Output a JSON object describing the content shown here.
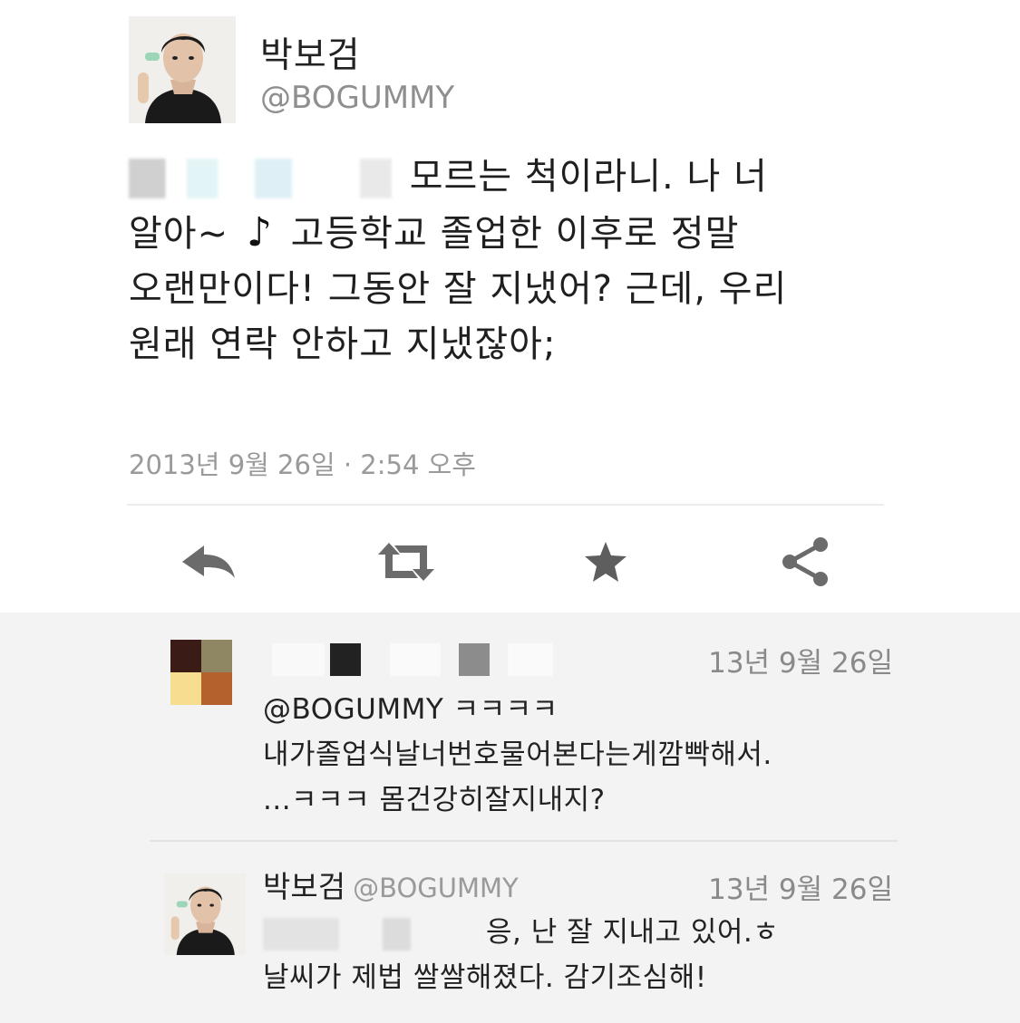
{
  "profile": {
    "display_name": "박보검",
    "handle": "@BOGUMMY",
    "avatar_icon": "person-avatar-icon"
  },
  "tweet": {
    "line1": "모르는 척이라니. 나 너",
    "line2_a": "알아~",
    "line2_note": "♪",
    "line2_b": "고등학교 졸업한 이후로 정말",
    "line3": "오랜만이다! 그동안 잘 지냈어? 근데, 우리",
    "line4": "원래 연락 안하고 지냈잖아;",
    "timestamp": "2013년 9월 26일 · 2:54 오후"
  },
  "actions": {
    "reply_icon": "reply-arrow-icon",
    "retweet_icon": "retweet-icon",
    "favorite_icon": "star-icon",
    "share_icon": "share-icon"
  },
  "replies": [
    {
      "time": "13년 9월 26일",
      "lines": [
        "@BOGUMMY ㅋㅋㅋㅋ",
        "내가졸업식날너번호물어본다는게깜빡해서.",
        "...ㅋㅋㅋ 몸건강히잘지내지?"
      ],
      "mosaic_colors": [
        "#3b1b16",
        "#8f8663",
        "#f7dd8f",
        "#b5612d"
      ]
    },
    {
      "name": "박보검",
      "handle": "@BOGUMMY",
      "time": "13년 9월 26일",
      "lines": [
        "응, 난 잘 지내고 있어.ㅎ",
        "날씨가 제법 쌀쌀해졌다. 감기조심해!"
      ]
    }
  ],
  "colors": {
    "text": "#1f1f1f",
    "muted": "#9a9a9a",
    "icon": "#6b6b6b",
    "reply_bg": "#f3f3f3"
  }
}
